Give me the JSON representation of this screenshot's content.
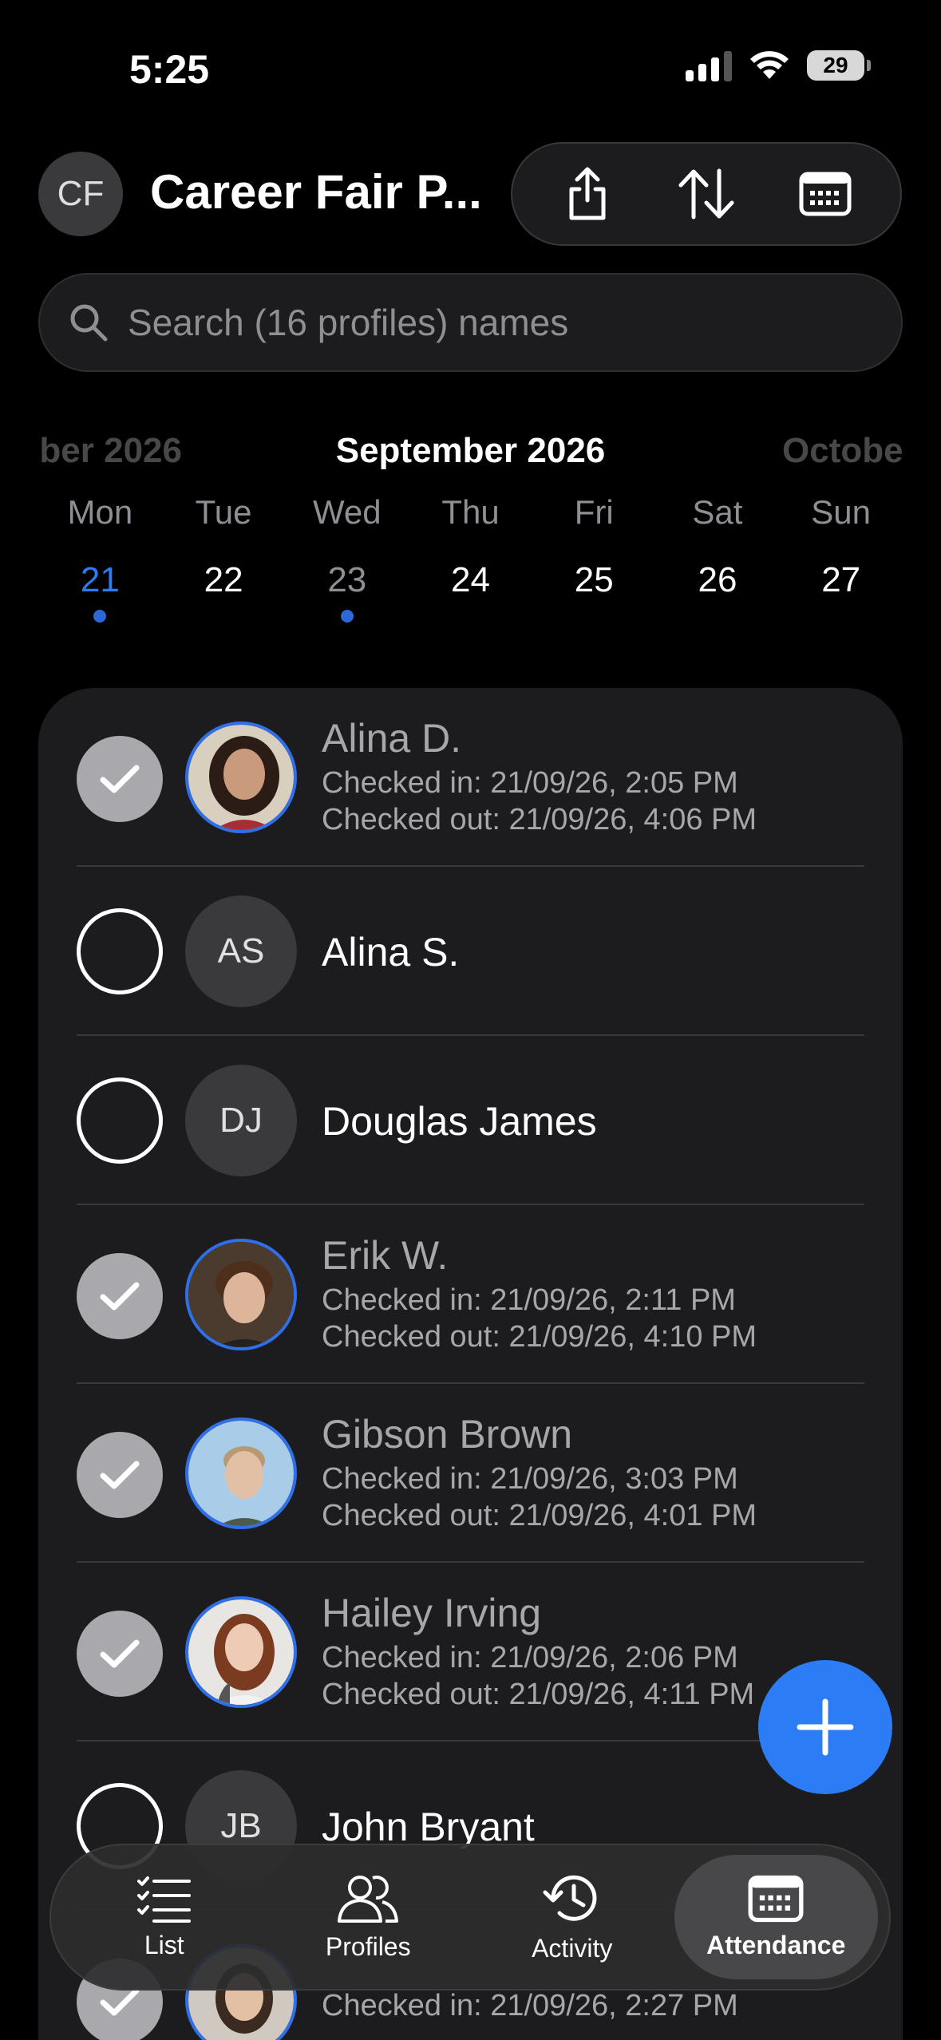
{
  "status_bar": {
    "time": "5:25",
    "battery": "29"
  },
  "header": {
    "avatar_initials": "CF",
    "title": "Career Fair P...",
    "toolbar_icons": [
      "share-icon",
      "sort-icon",
      "calendar-icon"
    ]
  },
  "search": {
    "placeholder": "Search (16 profiles) names",
    "value": ""
  },
  "calendar": {
    "prev_month": "ber 2026",
    "current_month": "September 2026",
    "next_month": "Octobe",
    "weekdays": [
      "Mon",
      "Tue",
      "Wed",
      "Thu",
      "Fri",
      "Sat",
      "Sun"
    ],
    "days": [
      "21",
      "22",
      "23",
      "24",
      "25",
      "26",
      "27"
    ],
    "selected_day": "21"
  },
  "profiles": [
    {
      "name": "Alina D.",
      "checked": true,
      "avatar": "photo",
      "checked_in": "Checked in: 21/09/26, 2:05 PM",
      "checked_out": "Checked out: 21/09/26, 4:06 PM"
    },
    {
      "name": "Alina S.",
      "checked": false,
      "avatar_initials": "AS"
    },
    {
      "name": "Douglas James",
      "checked": false,
      "avatar_initials": "DJ"
    },
    {
      "name": "Erik W.",
      "checked": true,
      "avatar": "photo",
      "checked_in": "Checked in: 21/09/26, 2:11 PM",
      "checked_out": "Checked out: 21/09/26, 4:10 PM"
    },
    {
      "name": "Gibson Brown",
      "checked": true,
      "avatar": "photo",
      "checked_in": "Checked in: 21/09/26, 3:03 PM",
      "checked_out": "Checked out: 21/09/26, 4:01 PM"
    },
    {
      "name": "Hailey Irving",
      "checked": true,
      "avatar": "photo",
      "checked_in": "Checked in: 21/09/26, 2:06 PM",
      "checked_out": "Checked out: 21/09/26, 4:11 PM"
    },
    {
      "name": "John Bryant",
      "checked": false,
      "avatar_initials": "JB"
    },
    {
      "name": "",
      "checked": true,
      "avatar": "photo",
      "checked_in": "Checked in: 21/09/26, 2:27 PM",
      "checked_out": ""
    }
  ],
  "fab": {
    "icon": "plus-icon"
  },
  "tabbar": {
    "tabs": [
      {
        "label": "List",
        "icon": "checklist-icon"
      },
      {
        "label": "Profiles",
        "icon": "people-icon"
      },
      {
        "label": "Activity",
        "icon": "history-icon"
      },
      {
        "label": "Attendance",
        "icon": "calendar-icon",
        "active": true
      }
    ]
  },
  "colors": {
    "accent": "#2c7cf6",
    "background": "#000000",
    "card": "#1c1c1e"
  }
}
